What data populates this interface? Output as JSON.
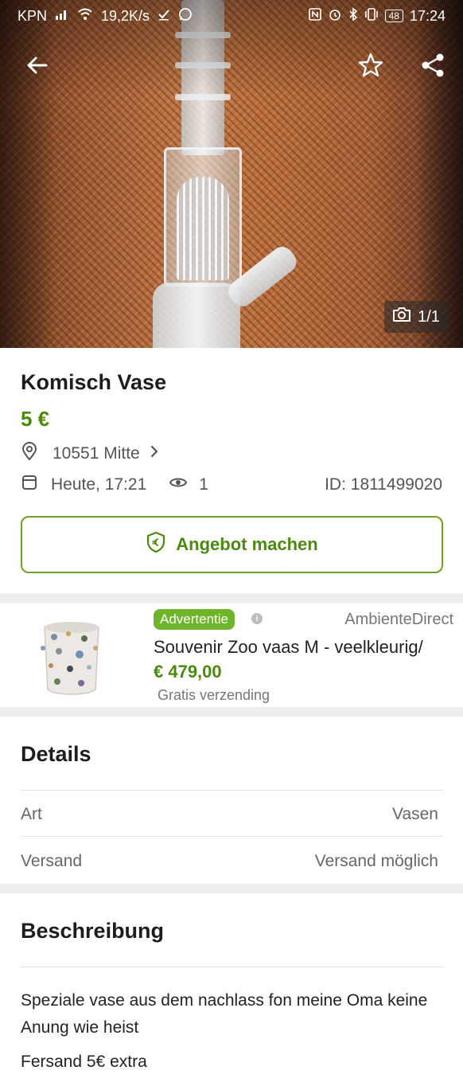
{
  "status_bar": {
    "carrier": "KPN",
    "network_speed": "19,2K/s",
    "battery": "48",
    "time": "17:24"
  },
  "hero": {
    "photo_counter": "1/1",
    "icons": {
      "back": "arrow-left-icon",
      "favorite": "star-outline-icon",
      "share": "share-icon",
      "camera": "camera-icon"
    }
  },
  "listing": {
    "title": "Komisch Vase",
    "price": "5 €",
    "location": "10551 Mitte",
    "date": "Heute, 17:21",
    "views": "1",
    "id": "ID: 1811499020",
    "offer_button": "Angebot machen"
  },
  "ad": {
    "badge": "Advertentie",
    "brand": "AmbienteDirect",
    "title": "Souvenir Zoo vaas M - veelkleurig/",
    "price": "€ 479,00",
    "shipping": "Gratis verzending"
  },
  "details": {
    "heading": "Details",
    "rows": [
      {
        "label": "Art",
        "value": "Vasen"
      },
      {
        "label": "Versand",
        "value": "Versand möglich"
      }
    ]
  },
  "description": {
    "heading": "Beschreibung",
    "text": "Speziale vase aus dem nachlass fon meine Oma keine Anung wie heist",
    "extra": "Fersand 5€ extra"
  },
  "colors": {
    "accent_green": "#4b8a0d",
    "badge_green": "#6fb52c"
  }
}
